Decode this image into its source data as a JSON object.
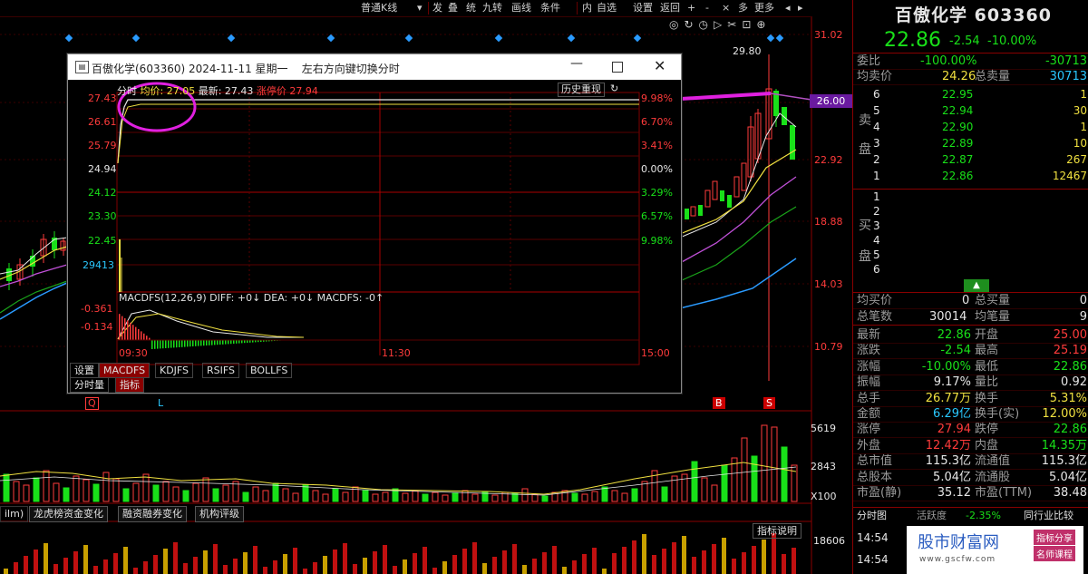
{
  "toolbar": {
    "items": [
      "普通K线",
      "▾",
      "发",
      "叠",
      "统",
      "九转",
      "画线",
      "条件",
      "内",
      "自选",
      "设置",
      "返回",
      "+",
      "-",
      "×",
      "多",
      "更多",
      "◂",
      "▸"
    ]
  },
  "stock": {
    "name": "百傲化学",
    "code": "603360",
    "price": "22.86",
    "change": "-2.54",
    "change_pct": "-10.00%",
    "color_down": "#19e019",
    "color_up": "#ff3b3b"
  },
  "quote_top": {
    "weibi_label": "委比",
    "weibi_value": "-100.00%",
    "weicha_value": "-30713",
    "avg_sell_label": "均卖价",
    "avg_sell_value": "24.26",
    "total_sell_label": "总卖量",
    "total_sell_value": "30713"
  },
  "sell_side_label": [
    "卖",
    "盘"
  ],
  "sell_levels": [
    {
      "level": "6",
      "price": "22.95",
      "vol": "1"
    },
    {
      "level": "5",
      "price": "22.94",
      "vol": "30"
    },
    {
      "level": "4",
      "price": "22.90",
      "vol": "1"
    },
    {
      "level": "3",
      "price": "22.89",
      "vol": "10"
    },
    {
      "level": "2",
      "price": "22.87",
      "vol": "267"
    },
    {
      "level": "1",
      "price": "22.86",
      "vol": "12467"
    }
  ],
  "buy_side_label": [
    "买",
    "盘"
  ],
  "buy_levels": [
    "1",
    "2",
    "3",
    "4",
    "5",
    "6"
  ],
  "avg_buy": {
    "label": "均买价",
    "value": "0",
    "total_label": "总买量",
    "total_value": "0"
  },
  "orders": {
    "label": "总笔数",
    "value": "30014",
    "avg_label": "均笔量",
    "avg_value": "9"
  },
  "stats": [
    {
      "l1": "最新",
      "v1": "22.86",
      "c1": "green",
      "l2": "开盘",
      "v2": "25.00",
      "c2": "red"
    },
    {
      "l1": "涨跌",
      "v1": "-2.54",
      "c1": "green",
      "l2": "最高",
      "v2": "25.19",
      "c2": "red"
    },
    {
      "l1": "涨幅",
      "v1": "-10.00%",
      "c1": "green",
      "l2": "最低",
      "v2": "22.86",
      "c2": "green"
    },
    {
      "l1": "振幅",
      "v1": "9.17%",
      "c1": "white",
      "l2": "量比",
      "v2": "0.92",
      "c2": "white"
    },
    {
      "l1": "总手",
      "v1": "26.77万",
      "c1": "yellow",
      "l2": "换手",
      "v2": "5.31%",
      "c2": "yellow"
    },
    {
      "l1": "金额",
      "v1": "6.29亿",
      "c1": "cyan",
      "l2": "换手(实)",
      "v2": "12.00%",
      "c2": "yellow"
    },
    {
      "l1": "涨停",
      "v1": "27.94",
      "c1": "red",
      "l2": "跌停",
      "v2": "22.86",
      "c2": "green"
    },
    {
      "l1": "外盘",
      "v1": "12.42万",
      "c1": "red",
      "l2": "内盘",
      "v2": "14.35万",
      "c2": "green"
    },
    {
      "l1": "总市值",
      "v1": "115.3亿",
      "c1": "white",
      "l2": "流通值",
      "v2": "115.3亿",
      "c2": "white"
    },
    {
      "l1": "总股本",
      "v1": "5.04亿",
      "c1": "white",
      "l2": "流通股",
      "v2": "5.04亿",
      "c2": "white"
    },
    {
      "l1": "市盈(静)",
      "v1": "35.12",
      "c1": "white",
      "l2": "市盈(TTM)",
      "v2": "38.48",
      "c2": "white"
    }
  ],
  "bottom_right": {
    "tab1": "分时图",
    "tab2_label": "活跃度",
    "tab2_value": "-2.35%",
    "tab3": "同行业比较",
    "time1": "14:54",
    "time2": "14:54"
  },
  "kline_axis": [
    "31.02",
    "26.00",
    "22.92",
    "18.88",
    "14.03",
    "10.79"
  ],
  "kline_labels": {
    "high": "29.80",
    "marker_q": "Q",
    "marker_l": "L",
    "marker_b": "B",
    "marker_s": "S"
  },
  "volume_axis": [
    "5619",
    "2843",
    "X100"
  ],
  "bottom_tabs": [
    "ilm)",
    "龙虎榜资金变化",
    "融资融券变化",
    "机构评级"
  ],
  "indicator_btn": "指标说明",
  "bottom_axis": "18606",
  "popup": {
    "title": "百傲化学(603360) 2024-11-11 星期一    左右方向键切换分时",
    "legend_time": "分时",
    "legend_avg": "均价: 27.05",
    "legend_latest": "最新: 27.43",
    "legend_limit": "涨停价 27.94",
    "history_btn": "历史重现",
    "left_axis": [
      "27.43",
      "26.61",
      "25.79",
      "24.94",
      "24.12",
      "23.30",
      "22.45"
    ],
    "right_axis": [
      "9.98%",
      "6.70%",
      "3.41%",
      "0.00%",
      "3.29%",
      "6.57%",
      "9.98%"
    ],
    "vol_label": "29413",
    "macd_title": "MACDFS(12,26,9) DIFF: +0↓ DEA: +0↓ MACDFS: -0↑",
    "macd_axis": [
      "-0.361",
      "-0.134"
    ],
    "time_axis": [
      "09:30",
      "11:30",
      "15:00"
    ],
    "tabs": [
      "设置",
      "MACDFS",
      "KDJFS",
      "RSIFS",
      "BOLLFS"
    ],
    "tabs2": [
      "分时量",
      "指标"
    ]
  },
  "watermark": {
    "title": "股市财富网",
    "tag1": "指标分享",
    "tag2": "名师课程",
    "url": "www.gscfw.com"
  }
}
